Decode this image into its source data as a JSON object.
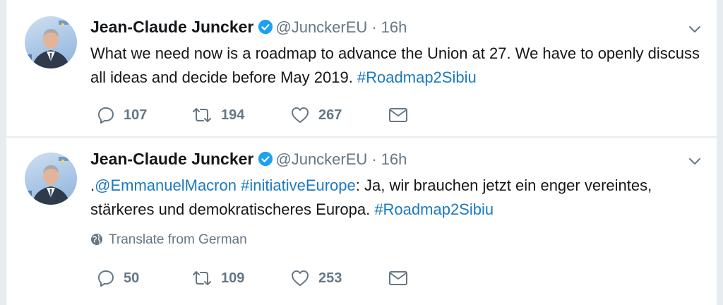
{
  "colors": {
    "background": "#e6ecf0",
    "card": "#ffffff",
    "link": "#1b7ac0",
    "muted": "#657786",
    "verified": "#1da1f2"
  },
  "icons": [
    "verified-badge-icon",
    "chevron-down-icon",
    "reply-icon",
    "retweet-icon",
    "like-icon",
    "direct-message-icon",
    "globe-icon"
  ],
  "tweets": [
    {
      "author": {
        "name": "Jean-Claude Juncker",
        "handle": "@JunckerEU",
        "separator": "·",
        "time": "16h"
      },
      "text": {
        "prefix": "",
        "mention": "",
        "hashtag_inline": "",
        "body": "What we need now is a roadmap to advance the Union at 27. We have to openly discuss all ideas and decide before May 2019. ",
        "hashtag": "#Roadmap2Sibiu"
      },
      "translate_label": "",
      "stats": {
        "replies": "107",
        "retweets": "194",
        "likes": "267"
      }
    },
    {
      "author": {
        "name": "Jean-Claude Juncker",
        "handle": "@JunckerEU",
        "separator": "·",
        "time": "16h"
      },
      "text": {
        "prefix": ".",
        "mention": "@EmmanuelMacron",
        "hashtag_inline": "#initiativeEurope",
        "body": ": Ja, wir brauchen jetzt ein enger vereintes, stärkeres und demokratischeres Europa. ",
        "hashtag": "#Roadmap2Sibiu"
      },
      "translate_label": "Translate from German",
      "stats": {
        "replies": "50",
        "retweets": "109",
        "likes": "253"
      }
    }
  ]
}
